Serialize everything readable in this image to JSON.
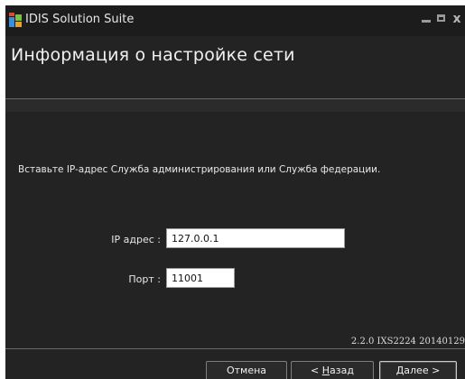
{
  "window": {
    "title": "IDIS Solution Suite",
    "controls": {
      "minimize": "minimize-icon",
      "maximize": "maximize-icon",
      "close": "x"
    }
  },
  "page": {
    "title": "Информация о настройке сети",
    "instruction": "Вставьте IP-адрес Служба администрирования или Служба федерации."
  },
  "form": {
    "ip_label": "IP адрес :",
    "ip_value": "127.0.0.1",
    "port_label": "Порт :",
    "port_value": "11001"
  },
  "footer": {
    "version": "2.2.0 IXS2224 20140129",
    "cancel_label": "Отмена",
    "back_prefix": "< ",
    "back_mnemonic": "Н",
    "back_rest": "азад",
    "next_mnemonic": "Д",
    "next_rest": "алее >"
  },
  "colors": {
    "window_bg": "#232323",
    "titlebar_bg": "#1c1c1c",
    "separator": "#6a6a6a",
    "text": "#e8e8e8"
  }
}
